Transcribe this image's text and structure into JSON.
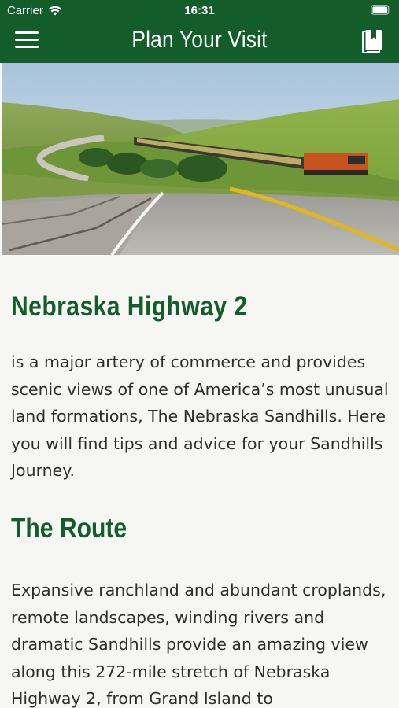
{
  "status_bar": {
    "carrier": "Carrier",
    "time": "16:31"
  },
  "header": {
    "title": "Plan Your Visit",
    "menu_icon": "hamburger-menu-icon",
    "bookmark_icon": "book-bookmark-icon",
    "background_color": "#125d2a"
  },
  "hero_image": {
    "description_icon": "highway-train-photo"
  },
  "sections": [
    {
      "heading": "Nebraska Highway 2",
      "body": "is a major artery of commerce and provides scenic views of one of America’s most unusual land formations, The Nebraska Sandhills. Here you will find tips and advice for your Sandhills Journey."
    },
    {
      "heading": "The Route",
      "body": "Expansive ranchland and abundant croplands, remote landscapes, winding rivers and dramatic Sandhills provide an amazing view along this 272-mile stretch of Nebraska Highway 2, from Grand Island to"
    }
  ],
  "colors": {
    "accent": "#125d2a",
    "page_background": "#f6f6f3",
    "body_text": "#2d2d2d"
  }
}
